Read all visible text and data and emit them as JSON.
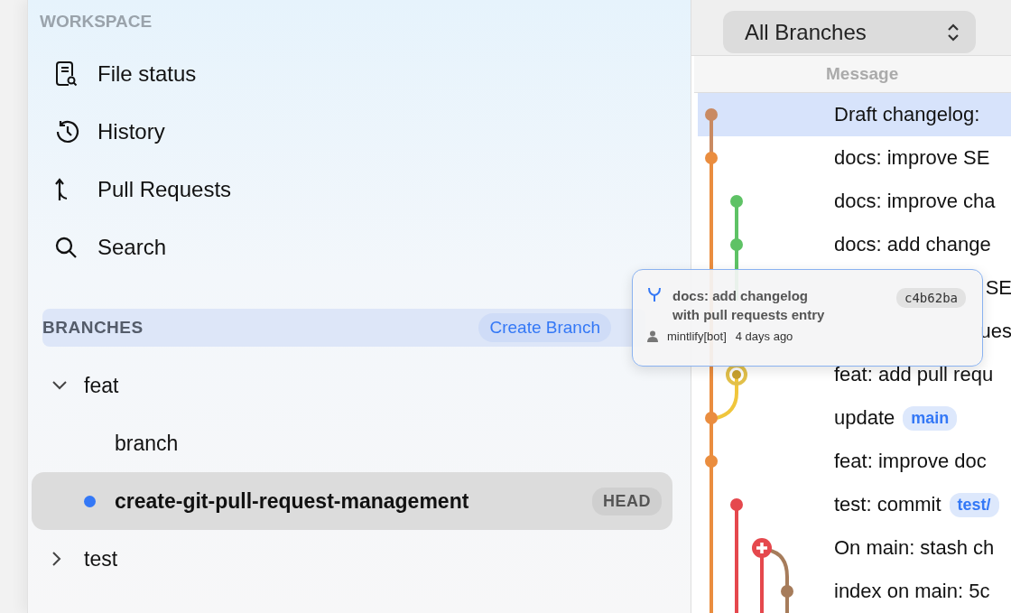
{
  "workspace": {
    "heading": "WORKSPACE",
    "items": [
      {
        "label": "File status",
        "kind": "file"
      },
      {
        "label": "History",
        "kind": "history"
      },
      {
        "label": "Pull Requests",
        "kind": "pull"
      },
      {
        "label": "Search",
        "kind": "search"
      }
    ]
  },
  "branches": {
    "heading": "BRANCHES",
    "action": "Create Branch",
    "tree": [
      {
        "label": "feat",
        "expanded": true,
        "selected": false,
        "children": [
          {
            "label": "branch",
            "selected": false
          },
          {
            "label": "create-git-pull-request-management",
            "selected": true,
            "badge": "HEAD"
          }
        ]
      },
      {
        "label": "test",
        "expanded": false,
        "selected": false
      }
    ]
  },
  "history": {
    "branch_filter": "All Branches",
    "columns": [
      "Message"
    ],
    "commits": [
      {
        "message": "Draft changelog:",
        "selected": true
      },
      {
        "message": "docs: improve SE",
        "selected": false
      },
      {
        "message": "docs: improve cha",
        "selected": false
      },
      {
        "message": "docs: add change",
        "selected": false
      },
      {
        "message": "SE",
        "selected": false,
        "kind": "partial"
      },
      {
        "message": "ues",
        "selected": false,
        "kind": "partial"
      },
      {
        "message": "feat: add pull requ",
        "selected": false
      },
      {
        "message": "update",
        "selected": false,
        "refs": [
          "main"
        ]
      },
      {
        "message": "feat: improve doc",
        "selected": false
      },
      {
        "message": "test: commit",
        "selected": false,
        "refs": [
          "test/"
        ]
      },
      {
        "message": "On main: stash ch",
        "selected": false
      },
      {
        "message": "index on main: 5c",
        "selected": false
      }
    ]
  },
  "tooltip": {
    "title_lines": [
      "docs: add changelog",
      "with pull requests entry"
    ],
    "hash": "c4b62ba",
    "author": "mintlify[bot]",
    "time": "4 days ago"
  }
}
